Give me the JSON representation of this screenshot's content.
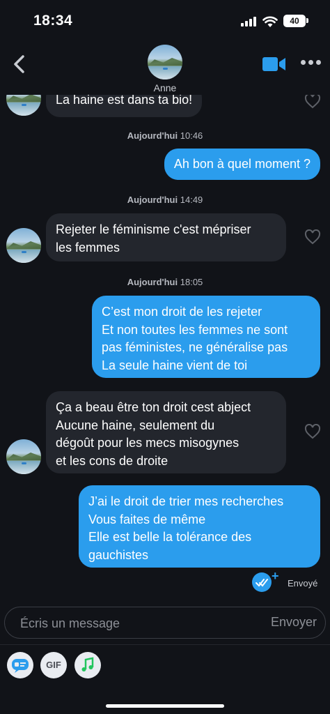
{
  "status_bar": {
    "time": "18:34",
    "battery": "40"
  },
  "header": {
    "contact_name": "Anne"
  },
  "messages": [
    {
      "type": "in",
      "text": "La haine est dans ta bio!"
    },
    {
      "type": "timestamp",
      "day": "Aujourd'hui",
      "time": "10:46"
    },
    {
      "type": "out",
      "text": "Ah bon à quel moment ?"
    },
    {
      "type": "timestamp",
      "day": "Aujourd'hui",
      "time": "14:49"
    },
    {
      "type": "in",
      "text": "Rejeter le féminisme c'est mépriser\nles femmes"
    },
    {
      "type": "timestamp",
      "day": "Aujourd'hui",
      "time": "18:05"
    },
    {
      "type": "out",
      "text": "C’est mon droit de les rejeter\nEt non toutes les femmes ne sont\npas féministes, ne généralise pas\nLa seule haine vient de toi"
    },
    {
      "type": "in",
      "text": "Ça a beau être ton droit cest abject\nAucune haine, seulement du\ndégoût pour les mecs misogynes\net les cons de droite"
    },
    {
      "type": "out",
      "text": "J’ai le droit de trier mes recherches\nVous faites de même\nElle est belle la tolérance des\ngauchistes"
    }
  ],
  "delivery_status": "Envoyé",
  "composer": {
    "placeholder": "Écris un message",
    "send_label": "Envoyer"
  },
  "toolbar": {
    "gif_label": "GIF"
  },
  "colors": {
    "background": "#111318",
    "incoming_bubble": "#23262d",
    "outgoing_bubble": "#2b9ded"
  }
}
